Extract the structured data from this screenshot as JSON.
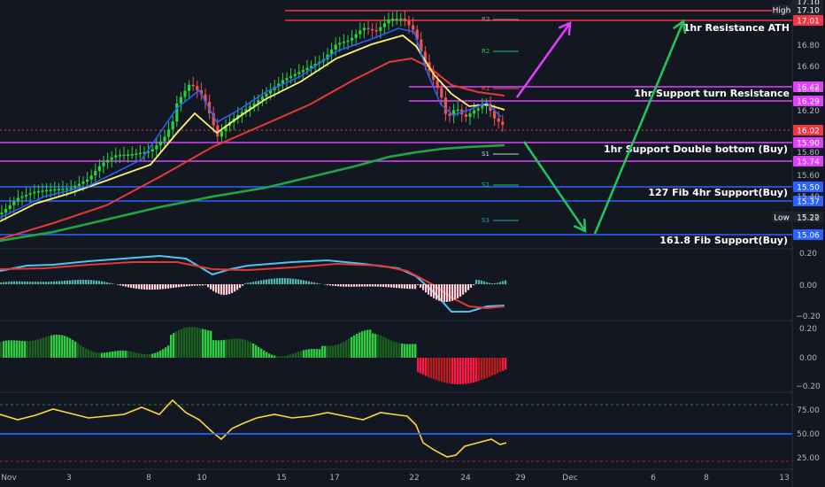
{
  "chart_data": [
    {
      "type": "candlestick",
      "yaxis_ticks": [
        17.1,
        16.8,
        16.6,
        16.4,
        16.2,
        16.0,
        15.8,
        15.6,
        15.4,
        15.2
      ],
      "ylim": [
        15.0,
        17.15
      ],
      "xaxis_ticks": [
        "Nov",
        "3",
        "8",
        "10",
        "15",
        "17",
        "22",
        "24",
        "29",
        "Dec",
        "6",
        "8",
        "13"
      ],
      "price_tags": [
        {
          "label": "",
          "value": "17.10",
          "color": "#1e222d"
        },
        {
          "label": "High",
          "value": "17.10",
          "color": "#1e222d"
        },
        {
          "label": "",
          "value": "17.01",
          "color": "#f23645"
        },
        {
          "label": "",
          "value": "16.42",
          "color": "#e040fb"
        },
        {
          "label": "",
          "value": "16.29",
          "color": "#e040fb"
        },
        {
          "label": "",
          "value": "16.02",
          "color": "#f23645"
        },
        {
          "label": "",
          "value": "15.90",
          "color": "#e040fb"
        },
        {
          "label": "",
          "value": "15.74",
          "color": "#e040fb"
        },
        {
          "label": "",
          "value": "15.50",
          "color": "#2962ff"
        },
        {
          "label": "",
          "value": "15.37",
          "color": "#2962ff"
        },
        {
          "label": "Low",
          "value": "15.22",
          "color": "#1e222d"
        },
        {
          "label": "",
          "value": "15.06",
          "color": "#2962ff"
        }
      ],
      "levels": [
        {
          "name": "1hr Resistance ATH",
          "value": 17.01,
          "color": "#f23645"
        },
        {
          "name": "1hr Support turn Resistance",
          "value": 16.42,
          "color": "#e040fb"
        },
        {
          "name": "",
          "value": 16.29,
          "color": "#e040fb"
        },
        {
          "name": "1hr Support Double bottom (Buy)",
          "value": 15.9,
          "color": "#e040fb"
        },
        {
          "name": "",
          "value": 15.74,
          "color": "#e040fb"
        },
        {
          "name": "127 Fib 4hr Support(Buy)",
          "value": 15.5,
          "color": "#2962ff"
        },
        {
          "name": "",
          "value": 15.37,
          "color": "#2962ff"
        },
        {
          "name": "161.8 Fib Support(Buy)",
          "value": 15.06,
          "color": "#2962ff"
        }
      ],
      "pivots": [
        "R3",
        "R2",
        "R1",
        "S1",
        "S2",
        "S3"
      ]
    },
    {
      "type": "histogram",
      "yaxis_ticks": [
        "0.20",
        "0.00",
        "−0.20"
      ]
    },
    {
      "type": "histogram",
      "yaxis_ticks": [
        "0.20",
        "0.00",
        "−0.20"
      ]
    },
    {
      "type": "line",
      "yaxis_ticks": [
        "75.00",
        "50.00",
        "25.00"
      ],
      "bands": [
        80,
        50,
        20
      ]
    }
  ]
}
